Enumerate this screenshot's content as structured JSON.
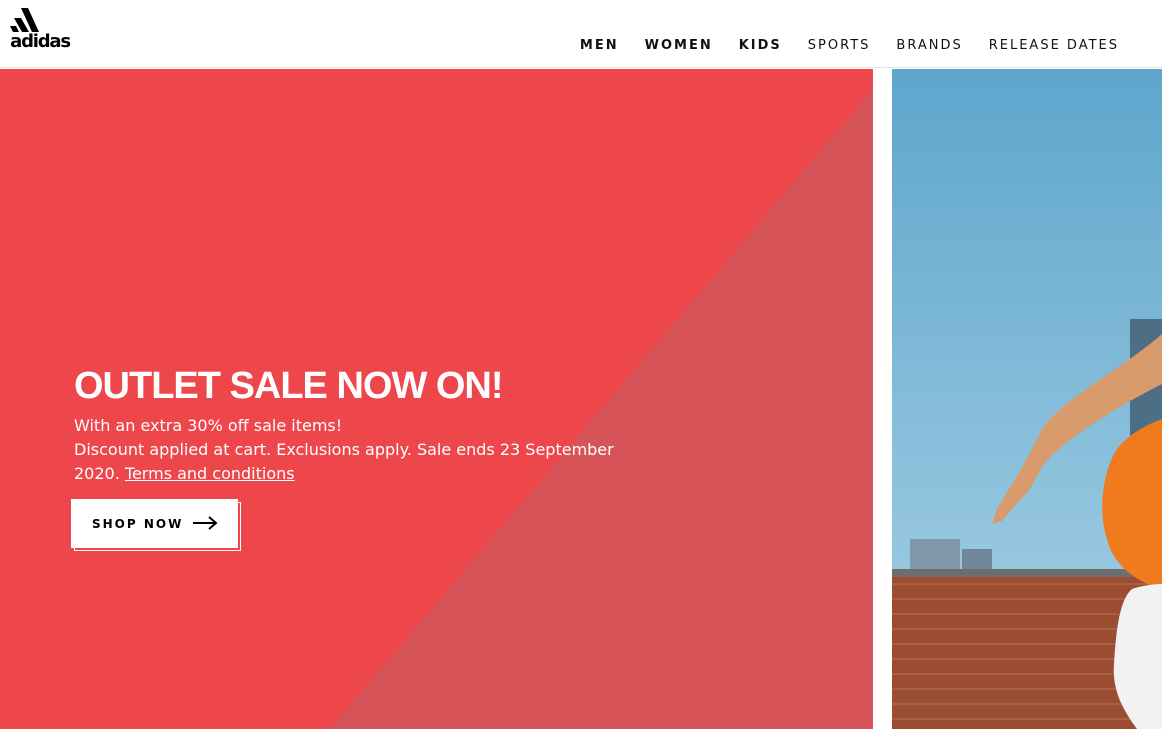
{
  "brand": {
    "logo_text": "adidas"
  },
  "nav": {
    "items": [
      {
        "label": "MEN",
        "weight": "bold"
      },
      {
        "label": "WOMEN",
        "weight": "bold"
      },
      {
        "label": "KIDS",
        "weight": "bold"
      },
      {
        "label": "SPORTS",
        "weight": "light"
      },
      {
        "label": "BRANDS",
        "weight": "light"
      },
      {
        "label": "RELEASE DATES",
        "weight": "light"
      }
    ]
  },
  "hero": {
    "title": "OUTLET SALE NOW ON!",
    "line1": "With an extra 30% off sale items!",
    "line2": "Discount applied at cart. Exclusions apply. Sale ends 23 September 2020.",
    "terms_link": "Terms and conditions",
    "cta_label": "SHOP NOW",
    "cta_icon": "arrow-right-icon"
  },
  "colors": {
    "hero_bg": "#ed474c",
    "hero_overlay": "#d65457",
    "text_primary": "#000000",
    "hero_text": "#ffffff"
  },
  "side_image": {
    "description_icon": "photo-runner-icon"
  }
}
